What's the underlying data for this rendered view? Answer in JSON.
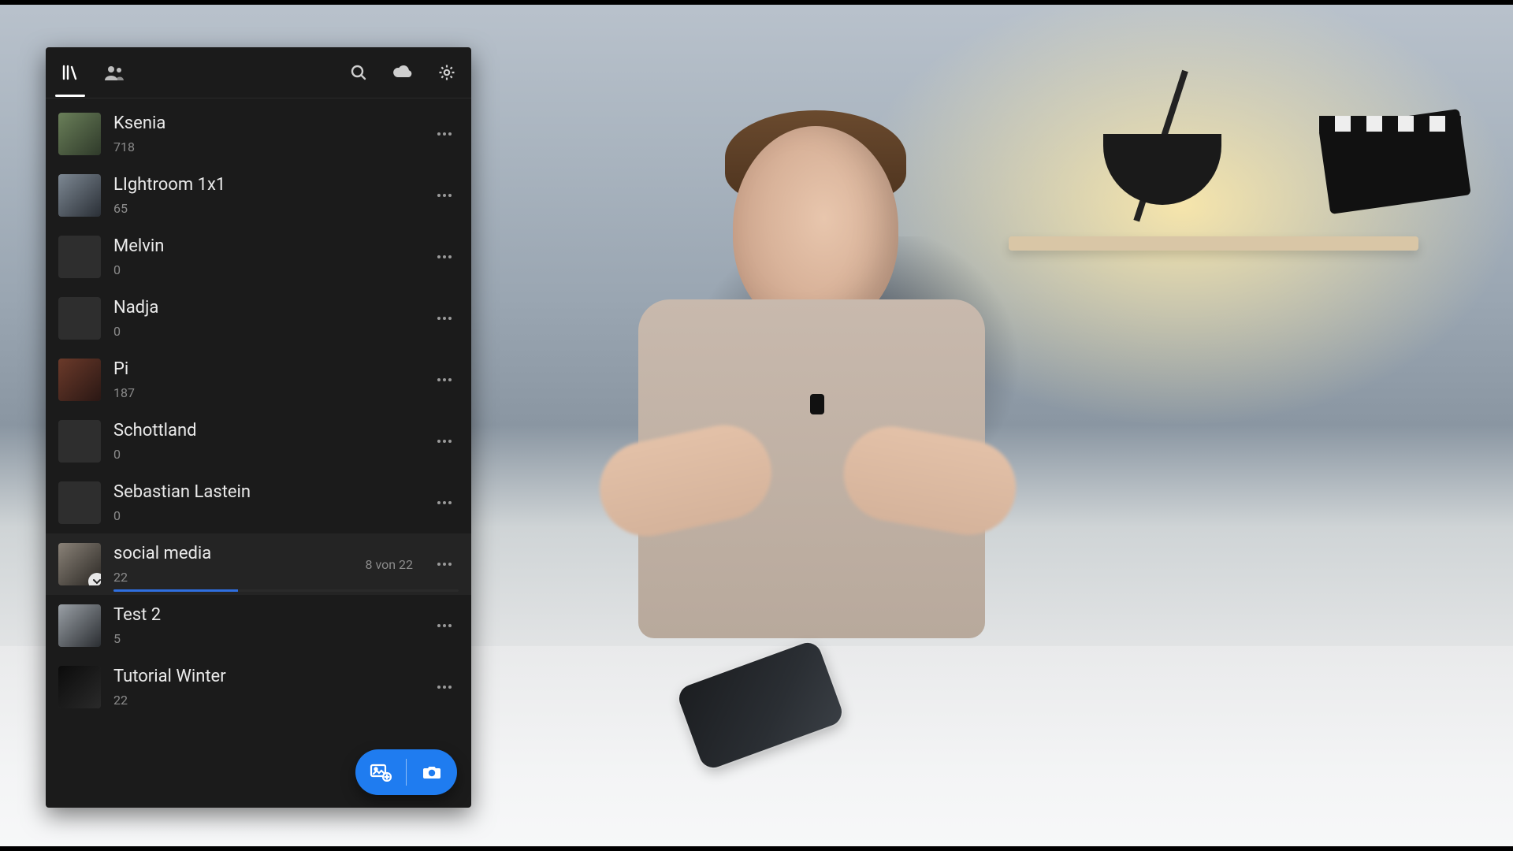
{
  "accent": "#1f7cf0",
  "albums": [
    {
      "id": "ksenia",
      "name": "Ksenia",
      "count": "718",
      "hasThumb": true,
      "thumbClass": "p1"
    },
    {
      "id": "lightroom-1x1",
      "name": "LIghtroom 1x1",
      "count": "65",
      "hasThumb": true,
      "thumbClass": "p2"
    },
    {
      "id": "melvin",
      "name": "Melvin",
      "count": "0",
      "hasThumb": false
    },
    {
      "id": "nadja",
      "name": "Nadja",
      "count": "0",
      "hasThumb": false
    },
    {
      "id": "pi",
      "name": "Pi",
      "count": "187",
      "hasThumb": true,
      "thumbClass": "p5"
    },
    {
      "id": "schottland",
      "name": "Schottland",
      "count": "0",
      "hasThumb": false
    },
    {
      "id": "sebastian-lastein",
      "name": "Sebastian Lastein",
      "count": "0",
      "hasThumb": false
    },
    {
      "id": "social-media",
      "name": "social media",
      "count": "22",
      "hasThumb": true,
      "thumbClass": "p8",
      "selected": true,
      "status": "8 von 22",
      "progressPct": 36,
      "syncBadge": true
    },
    {
      "id": "test-2",
      "name": "Test 2",
      "count": "5",
      "hasThumb": true,
      "thumbClass": "p9"
    },
    {
      "id": "tutorial-winter",
      "name": "Tutorial Winter",
      "count": "22",
      "hasThumb": true,
      "thumbClass": "p10"
    }
  ]
}
